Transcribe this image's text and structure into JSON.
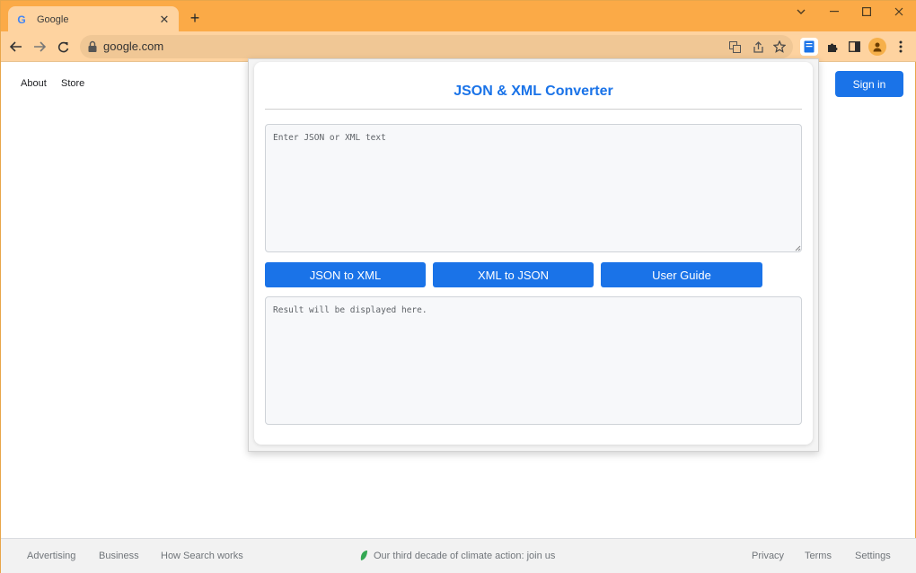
{
  "browser": {
    "tab": {
      "title": "Google",
      "favicon": "G"
    },
    "new_tab_glyph": "+",
    "url": "google.com",
    "window_controls": [
      "chevron-down",
      "minimize",
      "maximize",
      "close"
    ]
  },
  "page": {
    "top_links": {
      "about": "About",
      "store": "Store"
    },
    "sign_in": "Sign in",
    "footer": {
      "left": [
        "Advertising",
        "Business",
        "How Search works"
      ],
      "center": "Our third decade of climate action: join us",
      "right": [
        "Privacy",
        "Terms",
        "Settings"
      ]
    }
  },
  "popup": {
    "title": "JSON & XML Converter",
    "input_placeholder": "Enter JSON or XML text",
    "output_placeholder": "Result will be displayed here.",
    "buttons": {
      "json_to_xml": "JSON to XML",
      "xml_to_json": "XML to JSON",
      "user_guide": "User Guide"
    }
  },
  "colors": {
    "accent": "#1a73e8",
    "tabstrip": "#fbaa47",
    "toolbar": "#fed3a0",
    "footer": "#f2f2f2"
  }
}
